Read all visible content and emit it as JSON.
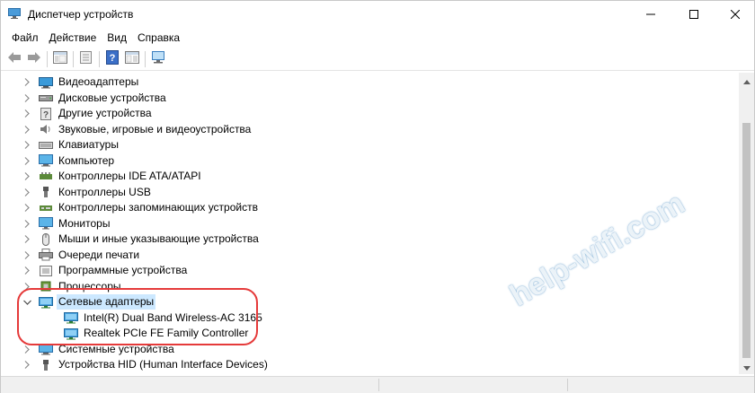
{
  "window": {
    "title": "Диспетчер устройств"
  },
  "menu": {
    "items": [
      "Файл",
      "Действие",
      "Вид",
      "Справка"
    ]
  },
  "toolbar": {
    "buttons": [
      "back-arrow-icon",
      "forward-arrow-icon",
      "properties-panel-icon",
      "update-driver-icon",
      "help-icon",
      "view-panel-icon",
      "monitor-scan-icon"
    ]
  },
  "tree": {
    "items": [
      {
        "label": "Видеоадаптеры",
        "icon": "display-adapter-icon",
        "expanded": false
      },
      {
        "label": "Дисковые устройства",
        "icon": "disk-drive-icon",
        "expanded": false
      },
      {
        "label": "Другие устройства",
        "icon": "unknown-device-icon",
        "expanded": false
      },
      {
        "label": "Звуковые, игровые и видеоустройства",
        "icon": "speaker-icon",
        "expanded": false
      },
      {
        "label": "Клавиатуры",
        "icon": "keyboard-icon",
        "expanded": false
      },
      {
        "label": "Компьютер",
        "icon": "computer-icon",
        "expanded": false
      },
      {
        "label": "Контроллеры IDE ATA/ATAPI",
        "icon": "ide-controller-icon",
        "expanded": false
      },
      {
        "label": "Контроллеры USB",
        "icon": "usb-icon",
        "expanded": false
      },
      {
        "label": "Контроллеры запоминающих устройств",
        "icon": "storage-controller-icon",
        "expanded": false
      },
      {
        "label": "Мониторы",
        "icon": "monitor-icon",
        "expanded": false
      },
      {
        "label": "Мыши и иные указывающие устройства",
        "icon": "mouse-icon",
        "expanded": false
      },
      {
        "label": "Очереди печати",
        "icon": "printer-icon",
        "expanded": false
      },
      {
        "label": "Программные устройства",
        "icon": "software-device-icon",
        "expanded": false
      },
      {
        "label": "Процессоры",
        "icon": "processor-icon",
        "expanded": false
      },
      {
        "label": "Сетевые адаптеры",
        "icon": "network-adapter-icon",
        "expanded": true,
        "selected": true
      },
      {
        "label": "Intel(R) Dual Band Wireless-AC 3165",
        "icon": "network-adapter-icon",
        "child": true
      },
      {
        "label": "Realtek PCIe FE Family Controller",
        "icon": "network-adapter-icon",
        "child": true
      },
      {
        "label": "Системные устройства",
        "icon": "system-device-icon",
        "expanded": false
      },
      {
        "label": "Устройства HID (Human Interface Devices)",
        "icon": "hid-device-icon",
        "expanded": false
      }
    ]
  },
  "watermark": {
    "text": "help-wifi.com"
  },
  "colors": {
    "selection": "#cce8ff",
    "highlight_oval": "#e53a3a",
    "scroll_thumb": "#c2c2c2"
  }
}
